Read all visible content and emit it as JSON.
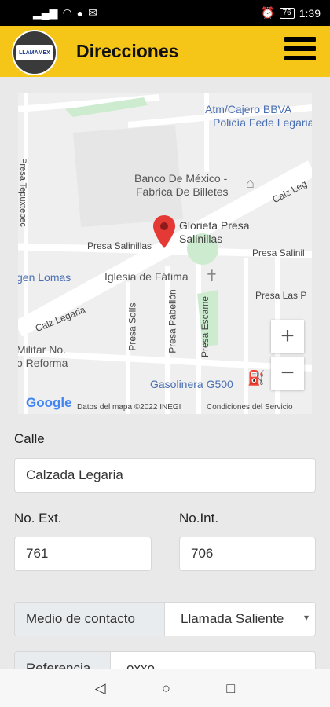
{
  "status_bar": {
    "time": "1:39",
    "battery": "76"
  },
  "header": {
    "title": "Direcciones",
    "logo_text": "LLAMAMEX"
  },
  "map": {
    "labels": {
      "atm": "Atm/Cajero BBVA",
      "policia": "Policía Fede Legaria",
      "banco1": "Banco De México -",
      "banco2": "Fabrica De Billetes",
      "calz_leg_top": "Calz Leg",
      "tepuxtepec": "Presa Tepuxtepec",
      "glorieta1": "Glorieta Presa",
      "glorieta2": "Salinillas",
      "presa_sal_left": "Presa Salinillas",
      "presa_sal_right": "Presa Salinil",
      "gen_lomas": "gen Lomas",
      "iglesia": "Iglesia de Fátima",
      "calz_legaria": "Calz Legaria",
      "presa_las": "Presa Las P",
      "presa_solis": "Presa Solís",
      "presa_pabellon": "Presa Pabellón",
      "presa_escame": "Presa Escame",
      "militar1": "Militar No.",
      "militar2": "o Reforma",
      "gasolinera": "Gasolinera G500"
    },
    "zoom_in": "+",
    "zoom_out": "−",
    "google": "Google",
    "attribution": "Datos del mapa ©2022 INEGI",
    "terms": "Condiciones del Servicio"
  },
  "form": {
    "calle_label": "Calle",
    "calle_value": "Calzada Legaria",
    "no_ext_label": "No. Ext.",
    "no_ext_value": "761",
    "no_int_label": "No.Int.",
    "no_int_value": "706",
    "medio_label": "Medio de contacto",
    "medio_value": "Llamada Saliente",
    "referencia_label": "Referencia",
    "referencia_value": "oxxo"
  },
  "nav": {
    "back": "◁",
    "home": "○",
    "recent": "□"
  }
}
